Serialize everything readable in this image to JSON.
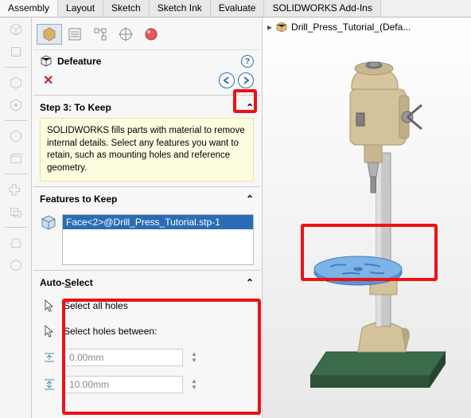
{
  "tabs": [
    "Assembly",
    "Layout",
    "Sketch",
    "Sketch Ink",
    "Evaluate",
    "SOLIDWORKS Add-Ins"
  ],
  "active_tab": 0,
  "tree": {
    "root": "Drill_Press_Tutorial_(Defa..."
  },
  "panel": {
    "title": "Defeature",
    "step_title": "Step 3: To Keep",
    "step_body": "SOLIDWORKS fills parts with material to remove internal details. Select any features you want to retain, such as mounting holes and reference geometry.",
    "features_title": "Features to Keep",
    "features_items": [
      "Face<2>@Drill_Press_Tutorial.stp-1"
    ],
    "auto": {
      "title": "Auto-Select",
      "opt1": "Select all holes",
      "opt2": "Select holes between:",
      "min": "0.00mm",
      "max": "10.00mm"
    }
  },
  "icons": {
    "defeature": "defeature-icon",
    "close": "close-icon",
    "help": "help-icon",
    "prev": "prev-icon",
    "next": "next-icon",
    "cube": "cube-icon",
    "cursor": "cursor-icon",
    "dim_min": "dim-min-icon",
    "dim_max": "dim-max-icon"
  }
}
